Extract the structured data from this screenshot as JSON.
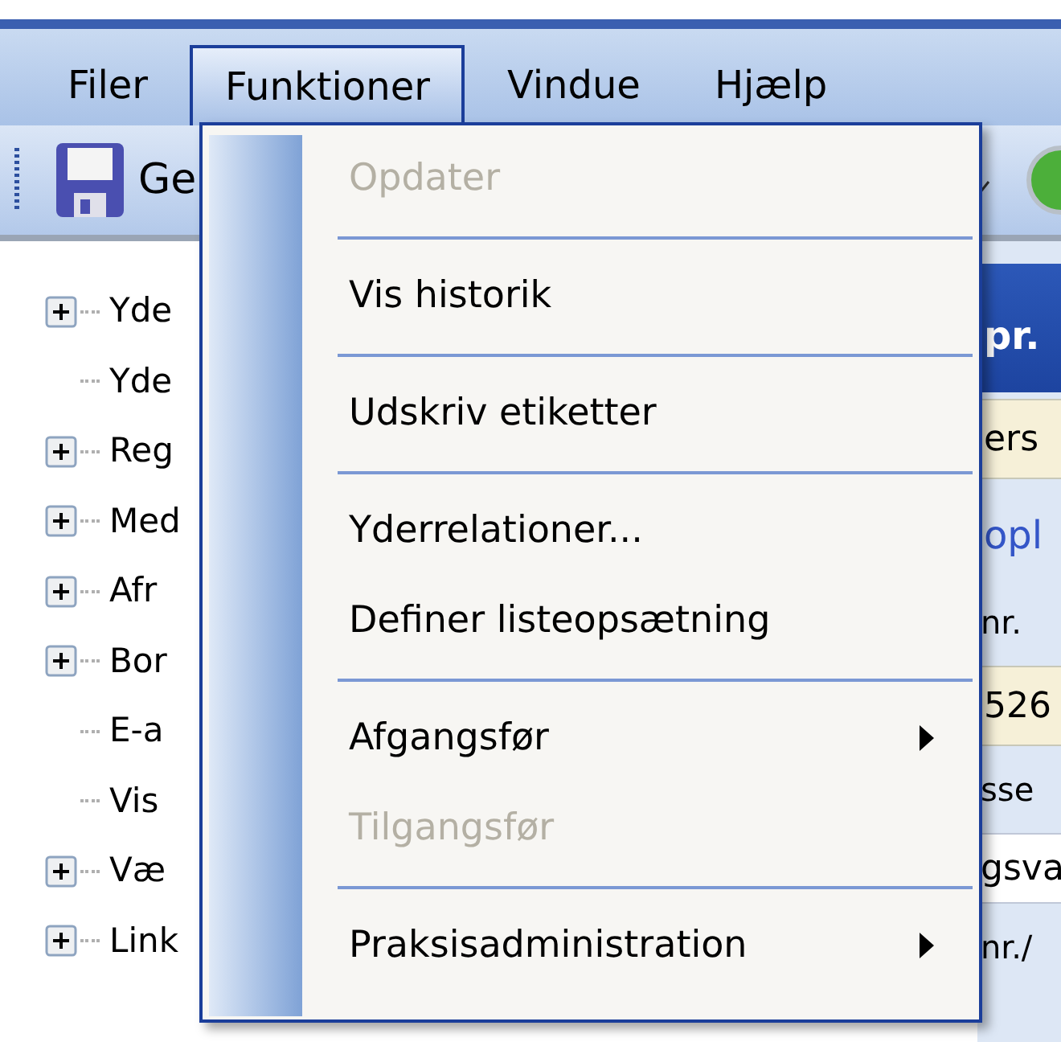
{
  "menu_bar": [
    {
      "label": "Filer",
      "selected": false
    },
    {
      "label": "Funktioner",
      "selected": true
    },
    {
      "label": "Vindue",
      "selected": false
    },
    {
      "label": "Hjælp",
      "selected": false
    }
  ],
  "toolbar": {
    "save_label": "Ge"
  },
  "tree": [
    {
      "label": "Yde",
      "expandable": true
    },
    {
      "label": "Yde",
      "expandable": false
    },
    {
      "label": "Reg",
      "expandable": true
    },
    {
      "label": "Med",
      "expandable": true
    },
    {
      "label": "Afr",
      "expandable": true
    },
    {
      "label": "Bor",
      "expandable": true
    },
    {
      "label": "E-a",
      "expandable": false
    },
    {
      "label": "Vis",
      "expandable": false
    },
    {
      "label": "Væ",
      "expandable": true
    },
    {
      "label": "Link",
      "expandable": true
    }
  ],
  "right_panel": {
    "header": "pr.",
    "rows": [
      {
        "kind": "field",
        "text": "ers"
      },
      {
        "kind": "link",
        "text": "opl"
      },
      {
        "kind": "label",
        "text": "nr."
      },
      {
        "kind": "field",
        "text": "526"
      },
      {
        "kind": "label",
        "text": "sse"
      },
      {
        "kind": "input",
        "text": "gsva"
      },
      {
        "kind": "label",
        "text": "nr./"
      }
    ]
  },
  "menu": [
    {
      "kind": "item",
      "label": "Opdater",
      "disabled": true,
      "submenu": false
    },
    {
      "kind": "separator"
    },
    {
      "kind": "item",
      "label": "Vis historik",
      "disabled": false,
      "submenu": false
    },
    {
      "kind": "separator"
    },
    {
      "kind": "item",
      "label": "Udskriv etiketter",
      "disabled": false,
      "submenu": false
    },
    {
      "kind": "separator"
    },
    {
      "kind": "item",
      "label": "Yderrelationer...",
      "disabled": false,
      "submenu": false
    },
    {
      "kind": "item",
      "label": "Definer listeopsætning",
      "disabled": false,
      "submenu": false
    },
    {
      "kind": "separator"
    },
    {
      "kind": "item",
      "label": "Afgangsfør",
      "disabled": false,
      "submenu": true
    },
    {
      "kind": "item",
      "label": "Tilgangsfør",
      "disabled": true,
      "submenu": false
    },
    {
      "kind": "separator"
    },
    {
      "kind": "item",
      "label": "Praksisadministration",
      "disabled": false,
      "submenu": true
    }
  ]
}
